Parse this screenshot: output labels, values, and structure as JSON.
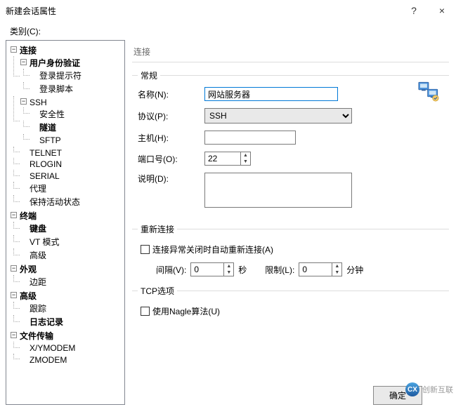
{
  "titlebar": {
    "title": "新建会话属性",
    "help": "?",
    "close": "×"
  },
  "categoryLabel": "类别(C):",
  "tree": {
    "connection": "连接",
    "userAuth": "用户身份验证",
    "loginPrompt": "登录提示符",
    "loginScript": "登录脚本",
    "ssh": "SSH",
    "security": "安全性",
    "tunnel": "隧道",
    "sftp": "SFTP",
    "telnet": "TELNET",
    "rlogin": "RLOGIN",
    "serial": "SERIAL",
    "proxy": "代理",
    "keepAlive": "保持活动状态",
    "terminal": "终端",
    "keyboard": "键盘",
    "vtMode": "VT 模式",
    "advancedT": "高级",
    "appearance": "外观",
    "margin": "边距",
    "advanced": "高级",
    "trace": "跟踪",
    "log": "日志记录",
    "fileTransfer": "文件传输",
    "xymodem": "X/YMODEM",
    "zmodem": "ZMODEM"
  },
  "right": {
    "heading": "连接",
    "general": "常规",
    "nameLabel": "名称(N):",
    "nameValue": "网站服务器",
    "protoLabel": "协议(P):",
    "protoValue": "SSH",
    "hostLabel": "主机(H):",
    "hostValue": "",
    "portLabel": "端口号(O):",
    "portValue": "22",
    "descLabel": "说明(D):",
    "descValue": "",
    "reconnect": "重新连接",
    "reconnectChk": "连接异常关闭时自动重新连接(A)",
    "intervalLabel": "间隔(V):",
    "intervalValue": "0",
    "seconds": "秒",
    "limitLabel": "限制(L):",
    "limitValue": "0",
    "minutes": "分钟",
    "tcp": "TCP选项",
    "nagle": "使用Nagle算法(U)",
    "ok": "确定"
  },
  "watermark": "创新互联"
}
